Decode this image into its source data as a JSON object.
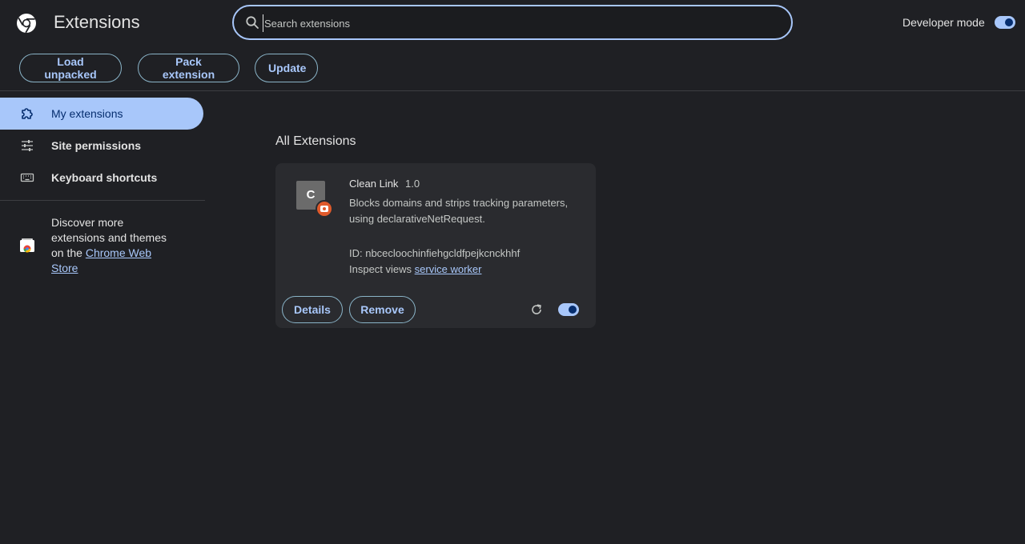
{
  "header": {
    "title": "Extensions",
    "search_placeholder": "Search extensions",
    "developer_mode_label": "Developer mode",
    "developer_mode_on": true
  },
  "toolbar": {
    "load_unpacked": "Load unpacked",
    "pack_extension": "Pack extension",
    "update": "Update"
  },
  "sidebar": {
    "items": [
      {
        "label": "My extensions",
        "icon": "puzzle-icon",
        "active": true
      },
      {
        "label": "Site permissions",
        "icon": "sliders-icon",
        "active": false
      },
      {
        "label": "Keyboard shortcuts",
        "icon": "keyboard-icon",
        "active": false
      }
    ],
    "discover_text": "Discover more extensions and themes on the ",
    "store_link": "Chrome Web Store"
  },
  "main": {
    "section_title": "All Extensions",
    "extension": {
      "icon_letter": "C",
      "name": "Clean Link",
      "version": "1.0",
      "description": "Blocks domains and strips tracking parameters, using declarativeNetRequest.",
      "id_text": "ID: nbcecloochinfiehgcldfpejkcnckhhf",
      "inspect_text": "Inspect views ",
      "inspect_link": "service worker",
      "details_label": "Details",
      "remove_label": "Remove",
      "enabled": true
    }
  },
  "colors": {
    "background": "#1f2024",
    "accent": "#a8c7fa",
    "card": "#2a2b2f",
    "badge": "#e05a2b"
  }
}
